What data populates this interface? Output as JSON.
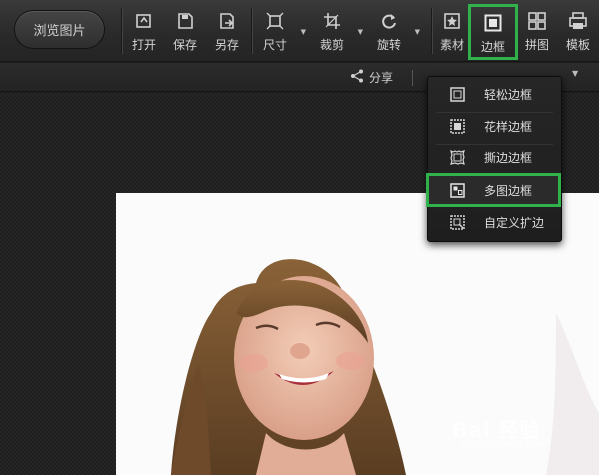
{
  "toolbar": {
    "browse_label": "浏览图片",
    "tools": [
      {
        "name": "open",
        "label": "打开",
        "icon": "open-icon"
      },
      {
        "name": "save",
        "label": "保存",
        "icon": "save-icon"
      },
      {
        "name": "save-as",
        "label": "另存",
        "icon": "save-as-icon"
      },
      {
        "name": "size",
        "label": "尺寸",
        "icon": "resize-icon"
      },
      {
        "name": "crop",
        "label": "裁剪",
        "icon": "crop-icon"
      },
      {
        "name": "rotate",
        "label": "旋转",
        "icon": "rotate-icon"
      },
      {
        "name": "material",
        "label": "素材",
        "icon": "star-icon"
      },
      {
        "name": "border",
        "label": "边框",
        "icon": "border-icon"
      },
      {
        "name": "collage",
        "label": "拼图",
        "icon": "collage-icon"
      },
      {
        "name": "template",
        "label": "模板",
        "icon": "template-icon"
      }
    ],
    "active_tool": "border",
    "highlight_color": "#2fb24a"
  },
  "subbar": {
    "share_label": "分享",
    "share_icon": "share-icon"
  },
  "border_menu": {
    "items": [
      {
        "label": "轻松边框",
        "icon": "simple-border-icon"
      },
      {
        "label": "花样边框",
        "icon": "pattern-border-icon"
      },
      {
        "label": "撕边边框",
        "icon": "torn-border-icon"
      },
      {
        "label": "多图边框",
        "icon": "multi-photo-border-icon"
      },
      {
        "label": "自定义扩边",
        "icon": "custom-extend-icon"
      }
    ],
    "highlighted": "多图边框"
  },
  "watermark": {
    "text": "Bai 经验",
    "sub": "jingyan.baidu.com"
  }
}
